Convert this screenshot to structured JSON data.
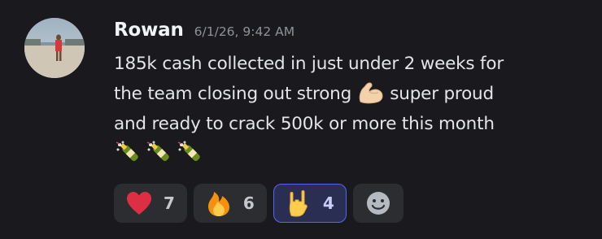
{
  "message": {
    "author": "Rowan",
    "timestamp": "6/1/26, 9:42 AM",
    "lines": [
      {
        "before": "185k cash collected in just under 2 weeks for",
        "emoji": "",
        "after": ""
      },
      {
        "before": "the team closing out strong ",
        "emoji": "flexed-biceps-icon",
        "after": " super proud"
      },
      {
        "before": "and ready to crack 500k or more this month",
        "emoji": "",
        "after": ""
      }
    ],
    "trailing_emojis": [
      "champagne-icon",
      "champagne-icon",
      "champagne-icon"
    ]
  },
  "reactions": [
    {
      "emoji": "red-heart-icon",
      "count": "7",
      "active": false
    },
    {
      "emoji": "fire-icon",
      "count": "6",
      "active": false
    },
    {
      "emoji": "rock-on-hand-icon",
      "count": "4",
      "active": true
    }
  ],
  "add_reaction": {
    "icon": "smiley-add-reaction-icon"
  },
  "colors": {
    "background": "#1a1a1e",
    "reaction_bg": "#2b2d31",
    "active_border": "#5865f2",
    "active_bg": "#2a2e52",
    "timestamp": "#8e9297"
  }
}
